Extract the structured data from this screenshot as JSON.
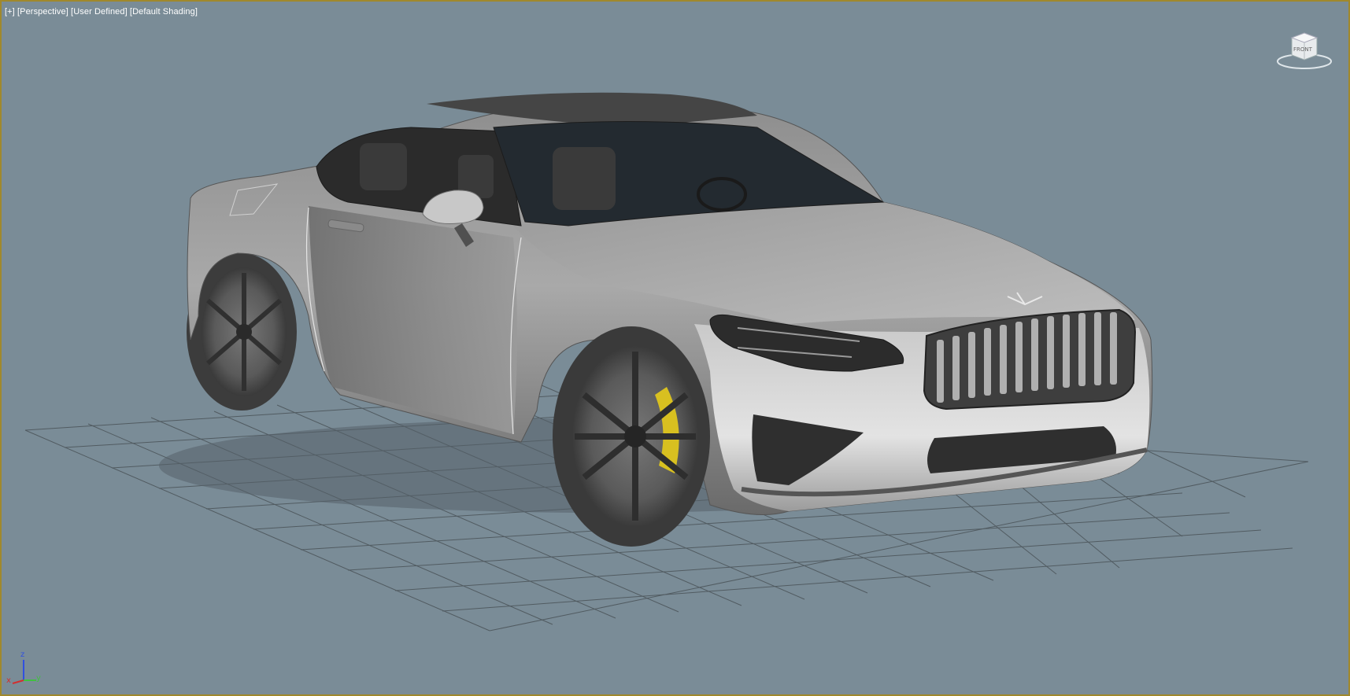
{
  "viewport": {
    "labels": {
      "view_menu": "[+]",
      "view_type": "[Perspective]",
      "view_mode": "[User Defined]",
      "shading": "[Default Shading]"
    },
    "active_border_color": "#a0882c",
    "background_color": "#7a8c97"
  },
  "viewcube": {
    "face_label": "FRONT",
    "icon": "viewcube-icon"
  },
  "axis_tripod": {
    "x_label": "x",
    "y_label": "y",
    "z_label": "z",
    "x_color": "#d03030",
    "y_color": "#40c040",
    "z_color": "#3050e0"
  },
  "scene": {
    "object": "car-model",
    "grid": true,
    "caliper_color": "#d8c020"
  }
}
